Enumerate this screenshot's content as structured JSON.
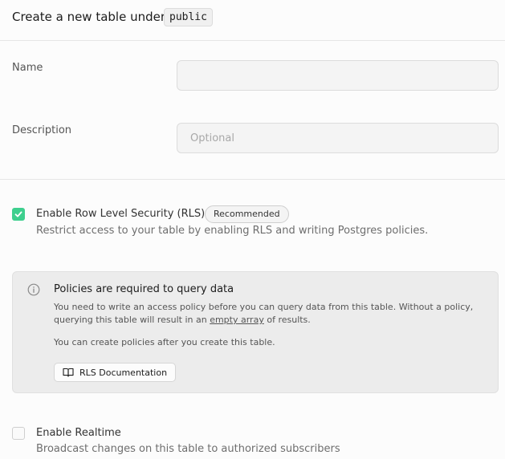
{
  "header": {
    "title": "Create a new table under",
    "schema": "public"
  },
  "form": {
    "name_label": "Name",
    "name_value": "",
    "name_placeholder": "",
    "description_label": "Description",
    "description_placeholder": "Optional"
  },
  "rls": {
    "checked": true,
    "title": "Enable Row Level Security (RLS)",
    "badge": "Recommended",
    "description": "Restrict access to your table by enabling RLS and writing Postgres policies."
  },
  "notice": {
    "title": "Policies are required to query data",
    "line1": "You need to write an access policy before you can query data from this table. Without a policy,",
    "line2_pre": "querying this table will result in an ",
    "line2_link": "empty array",
    "line2_post": " of results.",
    "line3": "You can create policies after you create this table.",
    "button_label": "RLS Documentation"
  },
  "realtime": {
    "checked": false,
    "title": "Enable Realtime",
    "description": "Broadcast changes on this table to authorized subscribers"
  },
  "colors": {
    "accent": "#3ecf8e",
    "background": "#fcfcfc"
  },
  "icons": {
    "notice": "info-icon",
    "doc_button": "book-icon",
    "checkbox": "checkmark-icon"
  }
}
